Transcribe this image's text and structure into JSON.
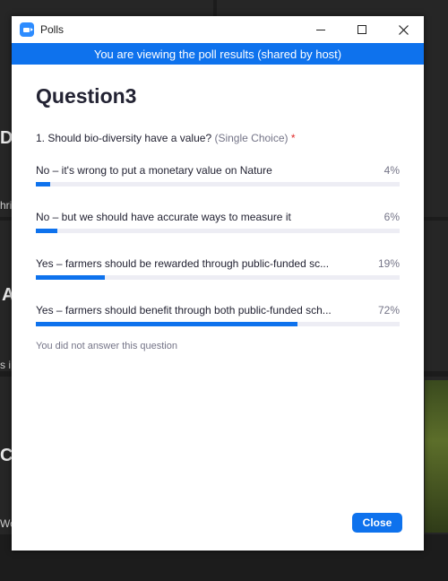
{
  "window": {
    "title": "Polls",
    "banner": "You are viewing the poll results (shared by host)"
  },
  "poll": {
    "heading": "Question3",
    "question": "1. Should bio-diversity have a value?",
    "question_type": "(Single Choice)",
    "required_mark": "*",
    "options": [
      {
        "label": "No – it's wrong to put a monetary value on Nature",
        "percent_text": "4%",
        "percent": 4
      },
      {
        "label": "No – but we should have accurate ways to measure it",
        "percent_text": "6%",
        "percent": 6
      },
      {
        "label": "Yes – farmers should be rewarded through public-funded sc...",
        "percent_text": "19%",
        "percent": 19
      },
      {
        "label": "Yes – farmers should benefit through both public-funded sch...",
        "percent_text": "72%",
        "percent": 72
      }
    ],
    "note": "You did not answer this question"
  },
  "footer": {
    "close_label": "Close"
  },
  "background": {
    "fragments": [
      "D",
      "hri",
      "A",
      "s iP",
      "C",
      "Wo"
    ]
  },
  "colors": {
    "accent": "#0e72ed",
    "track": "#ededf4",
    "required": "#e02828"
  },
  "icons": {
    "app": "zoom-camera-icon",
    "minimize": "minimize-icon",
    "maximize": "maximize-icon",
    "close": "close-icon"
  }
}
